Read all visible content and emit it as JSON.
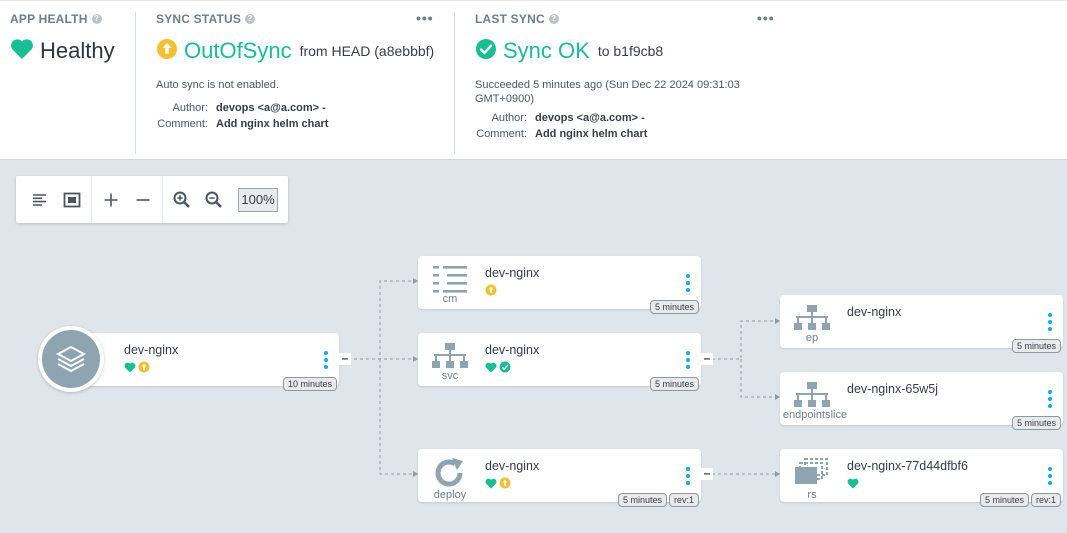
{
  "app_health": {
    "heading": "APP HEALTH",
    "status": "Healthy",
    "icon": "heart-icon",
    "color": "#18be94"
  },
  "sync_status": {
    "heading": "SYNC STATUS",
    "status": "OutOfSync",
    "suffix": "from HEAD (a8ebbbf)",
    "icon": "arrow-up-circle-icon",
    "color": "#f4c030",
    "auto_sync": "Auto sync is not enabled.",
    "author_label": "Author:",
    "author": "devops <a@a.com> -",
    "comment_label": "Comment:",
    "comment": "Add nginx helm chart",
    "menu": "•••"
  },
  "last_sync": {
    "heading": "LAST SYNC",
    "status": "Sync OK",
    "suffix": "to b1f9cb8",
    "icon": "check-circle-icon",
    "color": "#18be94",
    "succeeded_line1": "Succeeded 5 minutes ago (Sun Dec 22 2024 09:31:03",
    "succeeded_line2": "GMT+0900)",
    "author_label": "Author:",
    "author": "devops <a@a.com> -",
    "comment_label": "Comment:",
    "comment": "Add nginx helm chart",
    "menu": "•••"
  },
  "toolbar": {
    "zoom": "100%"
  },
  "nodes": {
    "app": {
      "name": "dev-nginx",
      "age": "10 minutes",
      "collapse": "–"
    },
    "cm": {
      "name": "dev-nginx",
      "kind": "cm",
      "age": "5 minutes"
    },
    "svc": {
      "name": "dev-nginx",
      "kind": "svc",
      "age": "5 minutes",
      "collapse": "–"
    },
    "deploy": {
      "name": "dev-nginx",
      "kind": "deploy",
      "age": "5 minutes",
      "rev": "rev:1",
      "collapse": "–"
    },
    "ep": {
      "name": "dev-nginx",
      "kind": "ep",
      "age": "5 minutes"
    },
    "endpointslice": {
      "name": "dev-nginx-65w5j",
      "kind": "endpointslice",
      "age": "5 minutes"
    },
    "rs": {
      "name": "dev-nginx-77d44dfbf6",
      "kind": "rs",
      "age": "5 minutes",
      "rev": "rev:1"
    }
  },
  "colors": {
    "healthy": "#18be94",
    "out_of_sync": "#f4c030",
    "kebab": "#0dadea",
    "icon_gray": "#8fa4b1"
  }
}
